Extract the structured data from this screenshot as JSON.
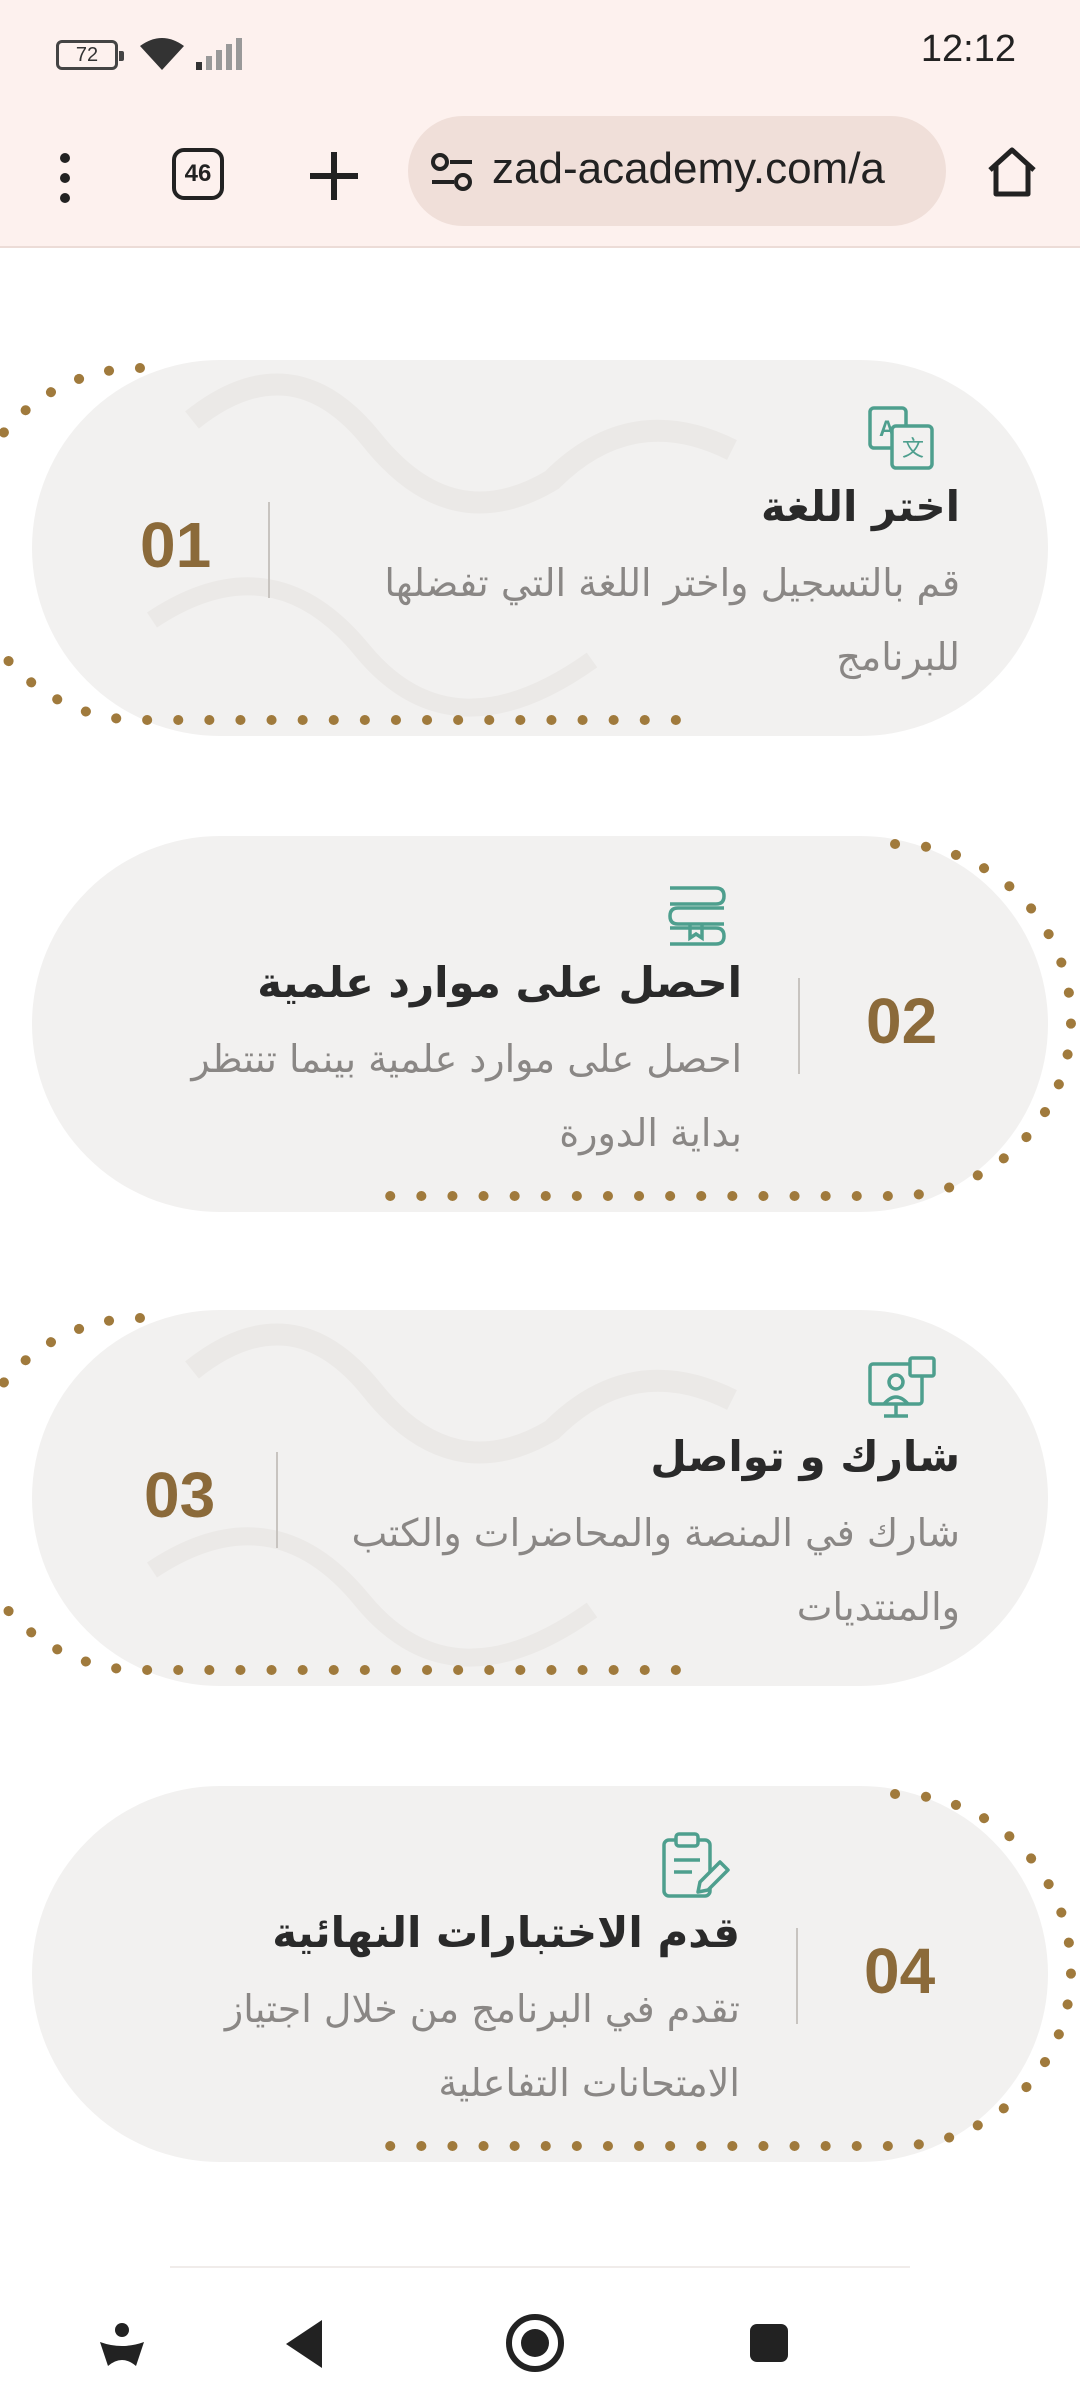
{
  "status_bar": {
    "battery": "72",
    "time": "12:12",
    "icons": [
      "battery-icon",
      "wifi-icon",
      "signal-icon"
    ]
  },
  "browser": {
    "tab_count": "46",
    "url": "zad-academy.com/a",
    "icons": [
      "menu-dots-icon",
      "tabs-icon",
      "new-tab-icon",
      "site-settings-icon",
      "home-icon"
    ]
  },
  "steps": [
    {
      "number": "01",
      "title": "اختر اللغة",
      "description": "قم بالتسجيل واختر اللغة التي تفضلها للبرنامج",
      "icon": "translate-icon"
    },
    {
      "number": "02",
      "title": "احصل على موارد علمية",
      "description": "احصل على موارد علمية بينما تنتظر بداية الدورة",
      "icon": "books-icon"
    },
    {
      "number": "03",
      "title": "شارك و تواصل",
      "description": "شارك في المنصة والمحاضرات والكتب والمنتديات",
      "icon": "presentation-icon"
    },
    {
      "number": "04",
      "title": "قدم الاختبارات النهائية",
      "description": "تقدم في البرنامج من خلال اجتياز الامتحانات التفاعلية",
      "icon": "clipboard-edit-icon"
    }
  ],
  "colors": {
    "accent_gold": "#a07a3c",
    "number_brown": "#8b6a3a",
    "icon_teal": "#4e9f8e",
    "card_bg": "#f2f1f0",
    "browser_bg": "#fdf1ee"
  },
  "nav": {
    "icons": [
      "accessibility-icon",
      "back-icon",
      "home-circle-icon",
      "recents-icon"
    ]
  }
}
